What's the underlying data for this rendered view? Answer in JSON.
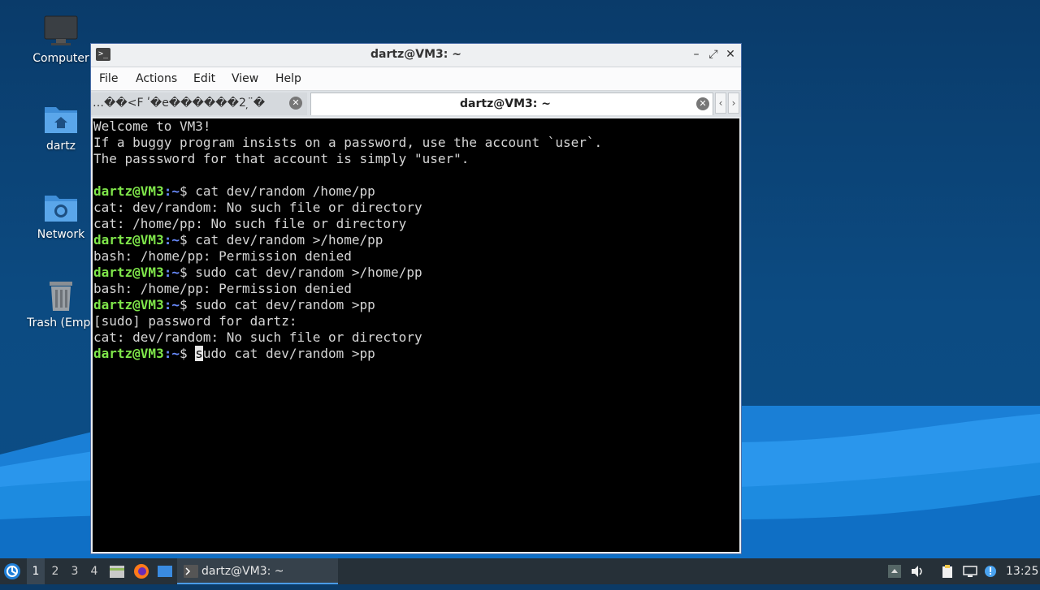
{
  "desktop": {
    "icons": [
      {
        "label": "Computer",
        "icon": "computer-icon"
      },
      {
        "label": "dartz",
        "icon": "home-folder-icon"
      },
      {
        "label": "Network",
        "icon": "network-folder-icon"
      },
      {
        "label": "Trash (Empt",
        "icon": "trash-icon"
      }
    ]
  },
  "window": {
    "title": "dartz@VM3: ~",
    "menu": [
      "File",
      "Actions",
      "Edit",
      "View",
      "Help"
    ],
    "tabs": [
      {
        "label": "…��<F ʹ�e������2 ̦ ̈́�",
        "active": false
      },
      {
        "label": "dartz@VM3: ~",
        "active": true
      }
    ]
  },
  "terminal": {
    "prompt_user": "dartz@VM3",
    "prompt_path": ":~",
    "prompt_symbol": "$ ",
    "lines": [
      {
        "type": "text",
        "text": "Welcome to VM3!"
      },
      {
        "type": "text",
        "text": "If a buggy program insists on a password, use the account `user`."
      },
      {
        "type": "text",
        "text": "The passsword for that account is simply \"user\"."
      },
      {
        "type": "text",
        "text": ""
      },
      {
        "type": "cmd",
        "text": "cat dev/random /home/pp"
      },
      {
        "type": "text",
        "text": "cat: dev/random: No such file or directory"
      },
      {
        "type": "text",
        "text": "cat: /home/pp: No such file or directory"
      },
      {
        "type": "cmd",
        "text": "cat dev/random >/home/pp"
      },
      {
        "type": "text",
        "text": "bash: /home/pp: Permission denied"
      },
      {
        "type": "cmd",
        "text": "sudo cat dev/random >/home/pp"
      },
      {
        "type": "text",
        "text": "bash: /home/pp: Permission denied"
      },
      {
        "type": "cmd",
        "text": "sudo cat dev/random >pp"
      },
      {
        "type": "text",
        "text": "[sudo] password for dartz:"
      },
      {
        "type": "text",
        "text": "cat: dev/random: No such file or directory"
      }
    ],
    "current_input_cursor_char": "s",
    "current_input_rest": "udo cat dev/random >pp"
  },
  "taskbar": {
    "workspaces": [
      "1",
      "2",
      "3",
      "4"
    ],
    "active_workspace": "1",
    "task_label": "dartz@VM3: ~",
    "clock": "13:25"
  },
  "colors": {
    "prompt_user": "#7fe64a",
    "prompt_path": "#6a8cff",
    "terminal_bg": "#000000",
    "desktop_bg": "#0b3a66",
    "accent": "#4b9be6"
  }
}
